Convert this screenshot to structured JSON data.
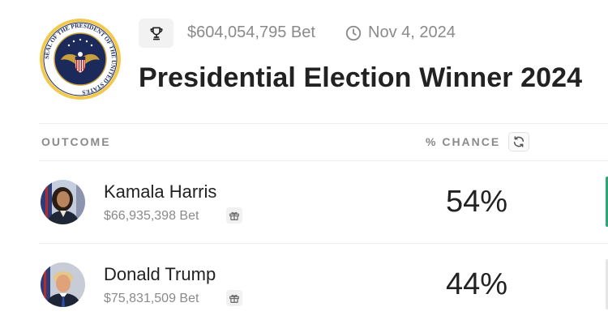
{
  "header": {
    "seal_text": "SEAL OF THE PRESIDENT OF THE UNITED STATES",
    "volume": "$604,054,795 Bet",
    "date": "Nov 4, 2024",
    "title": "Presidential Election Winner 2024",
    "icons": {
      "trophy": "trophy-icon",
      "clock": "clock-icon"
    }
  },
  "table": {
    "columns": {
      "outcome": "OUTCOME",
      "chance": "% CHANCE"
    },
    "rows": [
      {
        "name": "Kamala Harris",
        "bet": "$66,935,398 Bet",
        "chance": "54%",
        "avatar": "kamala-harris-photo"
      },
      {
        "name": "Donald Trump",
        "bet": "$75,831,509 Bet",
        "chance": "44%",
        "avatar": "donald-trump-photo"
      }
    ]
  },
  "colors": {
    "accent": "#2aa876",
    "muted_text": "#8a8a8a",
    "title_text": "#222222"
  }
}
